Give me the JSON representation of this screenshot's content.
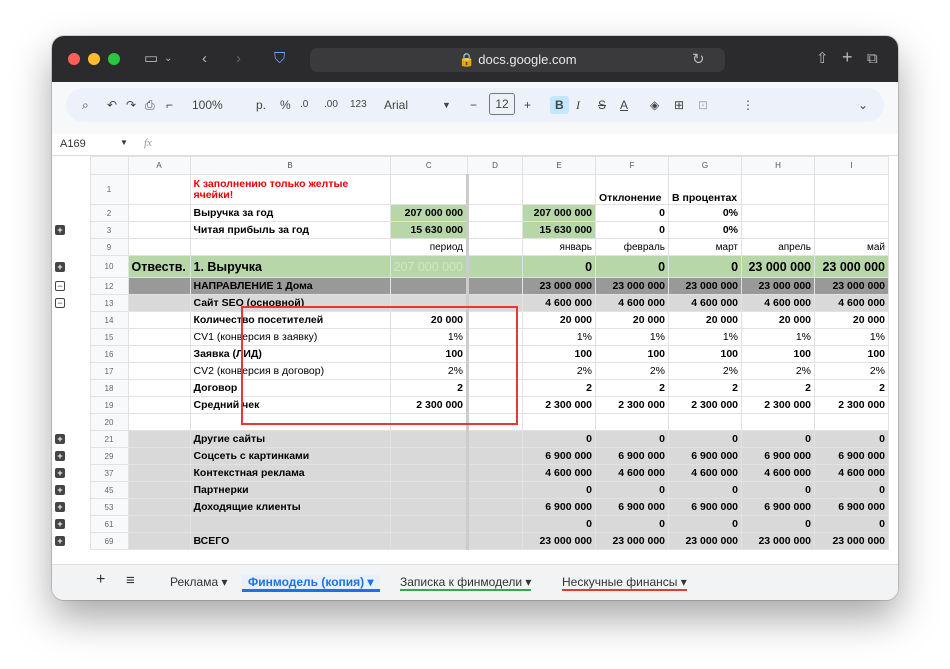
{
  "browser": {
    "url": "docs.google.com"
  },
  "toolbar": {
    "zoom": "100%",
    "currency": "р.",
    "percent": "%",
    "dec_dec": ".0",
    "dec_inc": ".00",
    "fmt123": "123",
    "font": "Arial",
    "font_size": "12",
    "bold": "B",
    "italic": "I",
    "strike": "S",
    "textcolor": "A"
  },
  "formula": {
    "cell_ref": "A169",
    "fx": "fx"
  },
  "columns": [
    "A",
    "B",
    "C",
    "D",
    "E",
    "F",
    "G",
    "H",
    "I"
  ],
  "rows": [
    {
      "n": "1",
      "A": "",
      "B": "К заполнению только желтые ячейки!",
      "C": "",
      "E": "",
      "F": "Отклонение",
      "G": "В процентах",
      "H": "",
      "I": ""
    },
    {
      "n": "2",
      "A": "",
      "B": "Выручка за год",
      "C": "207 000 000",
      "E": "207 000 000",
      "F": "0",
      "G": "0%",
      "H": "",
      "I": ""
    },
    {
      "n": "3",
      "A": "",
      "B": "Читая прибыль за год",
      "C": "15 630 000",
      "E": "15 630 000",
      "F": "0",
      "G": "0%",
      "H": "",
      "I": ""
    },
    {
      "n": "9",
      "A": "",
      "B": "",
      "C": "период",
      "E": "январь",
      "F": "февраль",
      "G": "март",
      "H": "апрель",
      "I": "май"
    },
    {
      "n": "10",
      "A": "Отвеств.",
      "B": "1. Выручка",
      "C": "207 000 000",
      "E": "0",
      "F": "0",
      "G": "0",
      "H": "23 000 000",
      "I": "23 000 000"
    },
    {
      "n": "12",
      "A": "",
      "B": "НАПРАВЛЕНИЕ 1 Дома",
      "C": "",
      "E": "23 000 000",
      "F": "23 000 000",
      "G": "23 000 000",
      "H": "23 000 000",
      "I": "23 000 000"
    },
    {
      "n": "13",
      "A": "",
      "B": "Сайт SEO (основной)",
      "C": "",
      "E": "4 600 000",
      "F": "4 600 000",
      "G": "4 600 000",
      "H": "4 600 000",
      "I": "4 600 000"
    },
    {
      "n": "14",
      "A": "",
      "B": "Количество посетителей",
      "C": "20 000",
      "E": "20 000",
      "F": "20 000",
      "G": "20 000",
      "H": "20 000",
      "I": "20 000"
    },
    {
      "n": "15",
      "A": "",
      "B": "CV1 (конверсия в заявку)",
      "C": "1%",
      "E": "1%",
      "F": "1%",
      "G": "1%",
      "H": "1%",
      "I": "1%"
    },
    {
      "n": "16",
      "A": "",
      "B": "Заявка (ЛИД)",
      "C": "100",
      "E": "100",
      "F": "100",
      "G": "100",
      "H": "100",
      "I": "100"
    },
    {
      "n": "17",
      "A": "",
      "B": "CV2 (конверсия в договор)",
      "C": "2%",
      "E": "2%",
      "F": "2%",
      "G": "2%",
      "H": "2%",
      "I": "2%"
    },
    {
      "n": "18",
      "A": "",
      "B": "Договор",
      "C": "2",
      "E": "2",
      "F": "2",
      "G": "2",
      "H": "2",
      "I": "2"
    },
    {
      "n": "19",
      "A": "",
      "B": "Средний чек",
      "C": "2 300 000",
      "E": "2 300 000",
      "F": "2 300 000",
      "G": "2 300 000",
      "H": "2 300 000",
      "I": "2 300 000"
    },
    {
      "n": "20",
      "A": "",
      "B": "",
      "C": "",
      "E": "",
      "F": "",
      "G": "",
      "H": "",
      "I": ""
    },
    {
      "n": "21",
      "A": "",
      "B": "Другие сайты",
      "C": "",
      "E": "0",
      "F": "0",
      "G": "0",
      "H": "0",
      "I": "0"
    },
    {
      "n": "29",
      "A": "",
      "B": "Соцсеть с картинками",
      "C": "",
      "E": "6 900 000",
      "F": "6 900 000",
      "G": "6 900 000",
      "H": "6 900 000",
      "I": "6 900 000"
    },
    {
      "n": "37",
      "A": "",
      "B": "Контекстная реклама",
      "C": "",
      "E": "4 600 000",
      "F": "4 600 000",
      "G": "4 600 000",
      "H": "4 600 000",
      "I": "4 600 000"
    },
    {
      "n": "45",
      "A": "",
      "B": "Партнерки",
      "C": "",
      "E": "0",
      "F": "0",
      "G": "0",
      "H": "0",
      "I": "0"
    },
    {
      "n": "53",
      "A": "",
      "B": "Доходящие клиенты",
      "C": "",
      "E": "6 900 000",
      "F": "6 900 000",
      "G": "6 900 000",
      "H": "6 900 000",
      "I": "6 900 000"
    },
    {
      "n": "61",
      "A": "",
      "B": "",
      "C": "",
      "E": "0",
      "F": "0",
      "G": "0",
      "H": "0",
      "I": "0"
    },
    {
      "n": "69",
      "A": "",
      "B": "ВСЕГО",
      "C": "",
      "E": "23 000 000",
      "F": "23 000 000",
      "G": "23 000 000",
      "H": "23 000 000",
      "I": "23 000 000"
    }
  ],
  "sheets": [
    "Реклама",
    "Финмодель (копия)",
    "Записка к финмодели",
    "Нескучные финансы"
  ],
  "colors": {
    "green": "#b7d7a8",
    "gray": "#d9d9d9",
    "dark_gray": "#999999",
    "red": "#e53935",
    "active_tab": "#1a73e8"
  }
}
